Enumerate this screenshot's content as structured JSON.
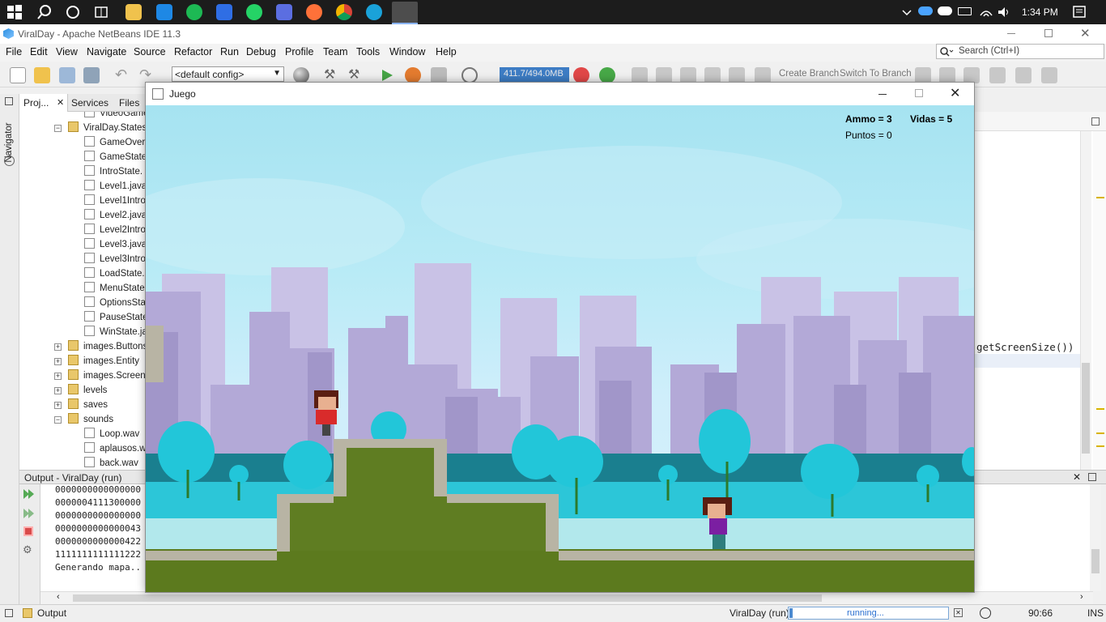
{
  "taskbar": {
    "clock": "1:34 PM",
    "icons": [
      "windows-start-icon",
      "search-icon",
      "cortana-icon",
      "task-view-icon",
      "file-explorer-icon",
      "mail-icon",
      "spotify-icon",
      "todo-icon",
      "whatsapp-icon",
      "security-icon",
      "firefox-icon",
      "chrome-icon",
      "edge-icon",
      "netbeans-icon"
    ]
  },
  "ide": {
    "title": "ViralDay - Apache NetBeans IDE 11.3",
    "menu": [
      "File",
      "Edit",
      "View",
      "Navigate",
      "Source",
      "Refactor",
      "Run",
      "Debug",
      "Profile",
      "Team",
      "Tools",
      "Window",
      "Help"
    ],
    "search_placeholder": "Search (Ctrl+I)",
    "config": "<default config>",
    "memory": "411.7/494.0MB",
    "create_branch": "Create Branch",
    "switch_branch": "Switch To Branch",
    "navigator_label": "Navigator",
    "panel_tabs": [
      "Proj...",
      "Services",
      "Files"
    ],
    "tree": [
      {
        "label": "VideoGame",
        "kind": "file",
        "indent": 2
      },
      {
        "label": "ViralDay.States",
        "kind": "pkg",
        "indent": 1,
        "expanded": true
      },
      {
        "label": "GameOverS",
        "kind": "file",
        "indent": 2
      },
      {
        "label": "GameState",
        "kind": "file",
        "indent": 2
      },
      {
        "label": "IntroState.",
        "kind": "file",
        "indent": 2
      },
      {
        "label": "Level1.java",
        "kind": "file",
        "indent": 2
      },
      {
        "label": "Level1Intro",
        "kind": "file",
        "indent": 2
      },
      {
        "label": "Level2.java",
        "kind": "file",
        "indent": 2
      },
      {
        "label": "Level2Intro",
        "kind": "file",
        "indent": 2
      },
      {
        "label": "Level3.java",
        "kind": "file",
        "indent": 2
      },
      {
        "label": "Level3Intro",
        "kind": "file",
        "indent": 2
      },
      {
        "label": "LoadState.",
        "kind": "file",
        "indent": 2
      },
      {
        "label": "MenuState",
        "kind": "file",
        "indent": 2
      },
      {
        "label": "OptionsSta",
        "kind": "file",
        "indent": 2
      },
      {
        "label": "PauseState",
        "kind": "file",
        "indent": 2
      },
      {
        "label": "WinState.ja",
        "kind": "file",
        "indent": 2
      },
      {
        "label": "images.Buttons",
        "kind": "pkg",
        "indent": 1,
        "expanded": false
      },
      {
        "label": "images.Entity",
        "kind": "pkg",
        "indent": 1,
        "expanded": false
      },
      {
        "label": "images.Screen",
        "kind": "pkg",
        "indent": 1,
        "expanded": false
      },
      {
        "label": "levels",
        "kind": "pkg",
        "indent": 1,
        "expanded": false
      },
      {
        "label": "saves",
        "kind": "pkg",
        "indent": 1,
        "expanded": false
      },
      {
        "label": "sounds",
        "kind": "pkg",
        "indent": 1,
        "expanded": true
      },
      {
        "label": "Loop.wav",
        "kind": "file",
        "indent": 2
      },
      {
        "label": "aplausos.w",
        "kind": "file",
        "indent": 2
      },
      {
        "label": "back.wav",
        "kind": "file",
        "indent": 2
      }
    ],
    "editor_code": "getScreenSize())",
    "output_title": "Output - ViralDay (run)",
    "output_lines": [
      "0000000000000000",
      "0000004111300000",
      "0000000000000000",
      "0000000000000043",
      "0000000000000422",
      "1111111111111222",
      "Generando mapa.."
    ],
    "status_output": "Output",
    "status_project": "ViralDay (run)",
    "status_running": "running...",
    "status_pos": "90:66",
    "status_ins": "INS"
  },
  "game": {
    "title": "Juego",
    "ammo": "Ammo = 3",
    "vidas": "Vidas = 5",
    "puntos": "Puntos = 0"
  },
  "colors": {
    "sky": "#a6e3f1",
    "building": "#b7aad6",
    "building_dark": "#a496c8",
    "tree": "#20c2d6",
    "grass": "#5c7a1e",
    "brick": "#b8b4a4",
    "water": "#b2e8ec"
  }
}
